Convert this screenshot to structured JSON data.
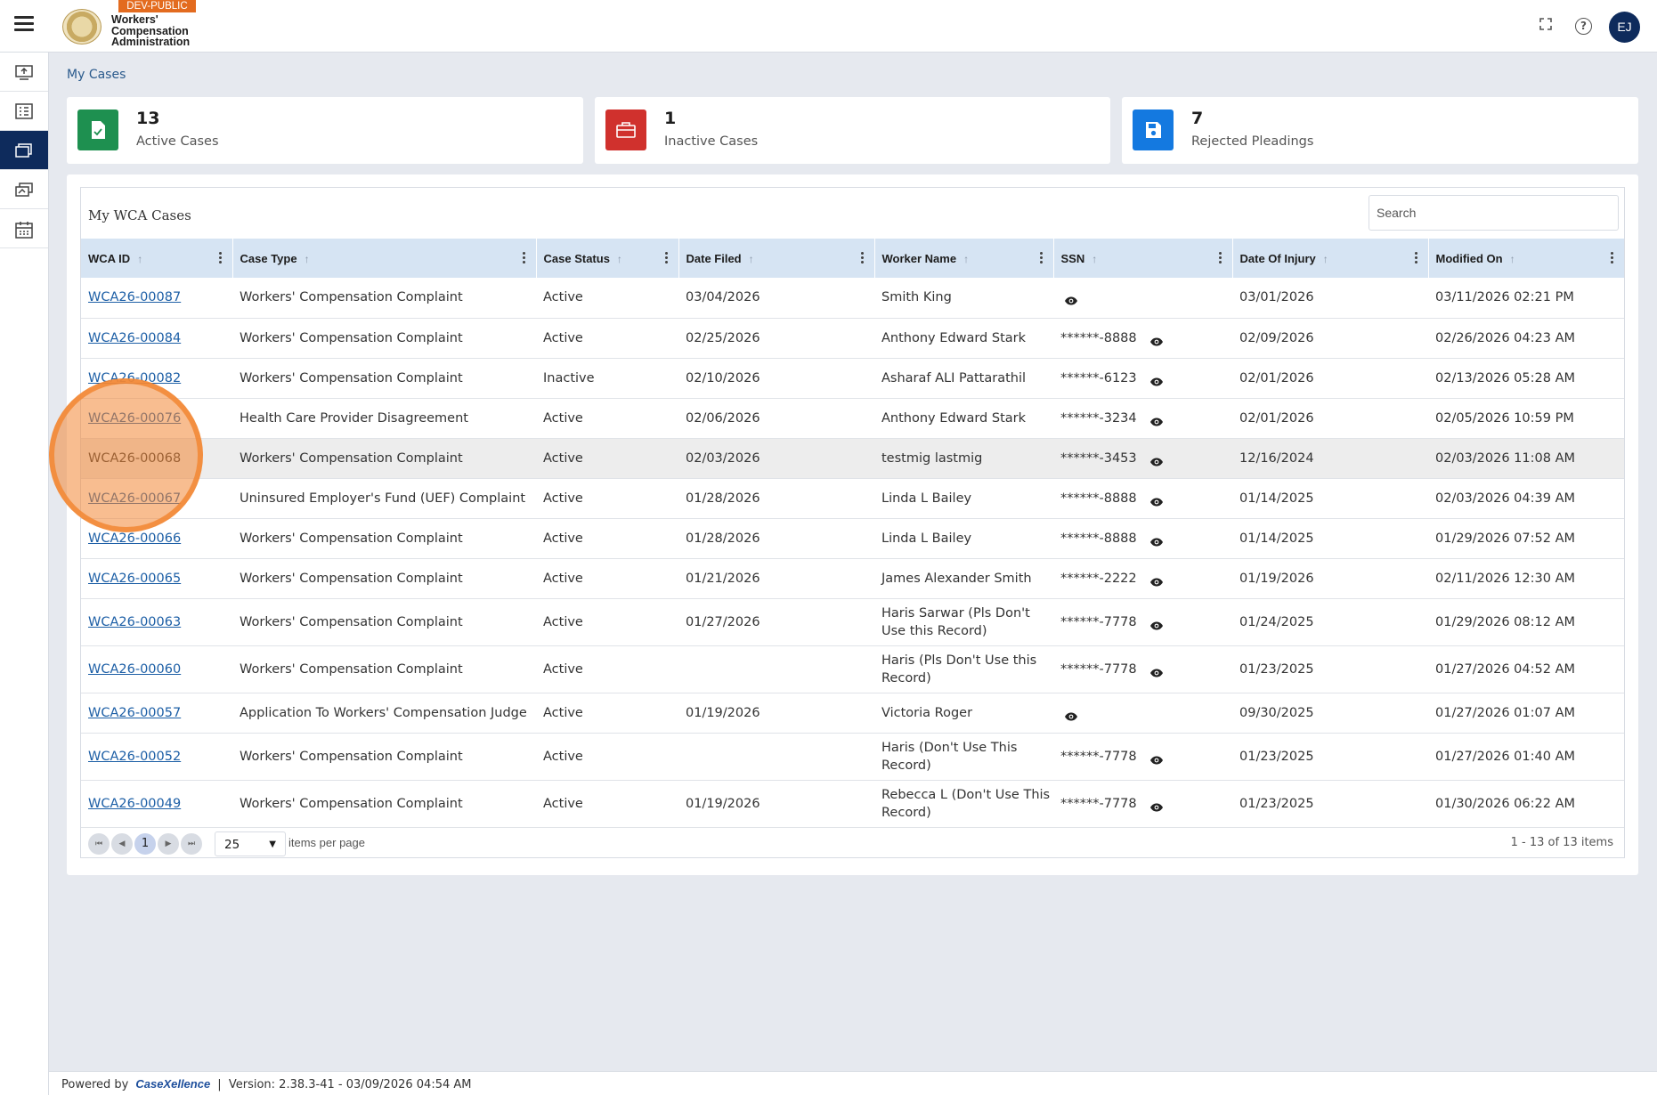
{
  "header": {
    "env_badge": "DEV-PUBLIC",
    "brand_line1": "Workers'",
    "brand_line2": "Compensation",
    "brand_line3": "Administration",
    "user_initials": "EJ"
  },
  "breadcrumb": "My Cases",
  "summary": [
    {
      "count": "13",
      "label": "Active Cases",
      "color": "#1e9050",
      "icon": "document-check-icon"
    },
    {
      "count": "1",
      "label": "Inactive Cases",
      "color": "#d0312d",
      "icon": "briefcase-icon"
    },
    {
      "count": "7",
      "label": "Rejected Pleadings",
      "color": "#1479e0",
      "icon": "save-icon"
    }
  ],
  "grid": {
    "title": "My WCA Cases",
    "search_placeholder": "Search",
    "columns": [
      "WCA ID",
      "Case Type",
      "Case Status",
      "Date Filed",
      "Worker Name",
      "SSN",
      "Date Of Injury",
      "Modified On"
    ],
    "rows": [
      {
        "id": "WCA26-00087",
        "type": "Workers' Compensation Complaint",
        "status": "Active",
        "filed": "03/04/2026",
        "worker": "Smith King",
        "ssn": "",
        "injury": "03/01/2026",
        "modified": "03/11/2026 02:21 PM"
      },
      {
        "id": "WCA26-00084",
        "type": "Workers' Compensation Complaint",
        "status": "Active",
        "filed": "02/25/2026",
        "worker": "Anthony Edward Stark",
        "ssn": "******-8888",
        "injury": "02/09/2026",
        "modified": "02/26/2026 04:23 AM"
      },
      {
        "id": "WCA26-00082",
        "type": "Workers' Compensation Complaint",
        "status": "Inactive",
        "filed": "02/10/2026",
        "worker": "Asharaf ALI Pattarathil",
        "ssn": "******-6123",
        "injury": "02/01/2026",
        "modified": "02/13/2026 05:28 AM"
      },
      {
        "id": "WCA26-00076",
        "type": "Health Care Provider Disagreement",
        "status": "Active",
        "filed": "02/06/2026",
        "worker": "Anthony Edward Stark",
        "ssn": "******-3234",
        "injury": "02/01/2026",
        "modified": "02/05/2026 10:59 PM"
      },
      {
        "id": "WCA26-00068",
        "type": "Workers' Compensation Complaint",
        "status": "Active",
        "filed": "02/03/2026",
        "worker": "testmig lastmig",
        "ssn": "******-3453",
        "injury": "12/16/2024",
        "modified": "02/03/2026 11:08 AM"
      },
      {
        "id": "WCA26-00067",
        "type": "Uninsured Employer's Fund (UEF) Complaint",
        "status": "Active",
        "filed": "01/28/2026",
        "worker": "Linda L Bailey",
        "ssn": "******-8888",
        "injury": "01/14/2025",
        "modified": "02/03/2026 04:39 AM"
      },
      {
        "id": "WCA26-00066",
        "type": "Workers' Compensation Complaint",
        "status": "Active",
        "filed": "01/28/2026",
        "worker": "Linda L Bailey",
        "ssn": "******-8888",
        "injury": "01/14/2025",
        "modified": "01/29/2026 07:52 AM"
      },
      {
        "id": "WCA26-00065",
        "type": "Workers' Compensation Complaint",
        "status": "Active",
        "filed": "01/21/2026",
        "worker": "James Alexander Smith",
        "ssn": "******-2222",
        "injury": "01/19/2026",
        "modified": "02/11/2026 12:30 AM"
      },
      {
        "id": "WCA26-00063",
        "type": "Workers' Compensation Complaint",
        "status": "Active",
        "filed": "01/27/2026",
        "worker": "Haris Sarwar (Pls Don't Use this Record)",
        "ssn": "******-7778",
        "injury": "01/24/2025",
        "modified": "01/29/2026 08:12 AM"
      },
      {
        "id": "WCA26-00060",
        "type": "Workers' Compensation Complaint",
        "status": "Active",
        "filed": "",
        "worker": "Haris (Pls Don't Use this Record)",
        "ssn": "******-7778",
        "injury": "01/23/2025",
        "modified": "01/27/2026 04:52 AM"
      },
      {
        "id": "WCA26-00057",
        "type": "Application To Workers' Compensation Judge",
        "status": "Active",
        "filed": "01/19/2026",
        "worker": "Victoria Roger",
        "ssn": "",
        "injury": "09/30/2025",
        "modified": "01/27/2026 01:07 AM"
      },
      {
        "id": "WCA26-00052",
        "type": "Workers' Compensation Complaint",
        "status": "Active",
        "filed": "",
        "worker": "Haris (Don't Use This Record)",
        "ssn": "******-7778",
        "injury": "01/23/2025",
        "modified": "01/27/2026 01:40 AM"
      },
      {
        "id": "WCA26-00049",
        "type": "Workers' Compensation Complaint",
        "status": "Active",
        "filed": "01/19/2026",
        "worker": "Rebecca L (Don't Use This Record)",
        "ssn": "******-7778",
        "injury": "01/23/2025",
        "modified": "01/30/2026 06:22 AM"
      }
    ]
  },
  "pager": {
    "current_page": "1",
    "page_size": "25",
    "items_per_page_label": "items per page",
    "count_text": "1 - 13 of 13 items"
  },
  "footer": {
    "powered_by": "Powered by",
    "brand": "CaseXellence",
    "separator": "|",
    "version": "Version: 2.38.3-41 - 03/09/2026 04:54 AM"
  }
}
